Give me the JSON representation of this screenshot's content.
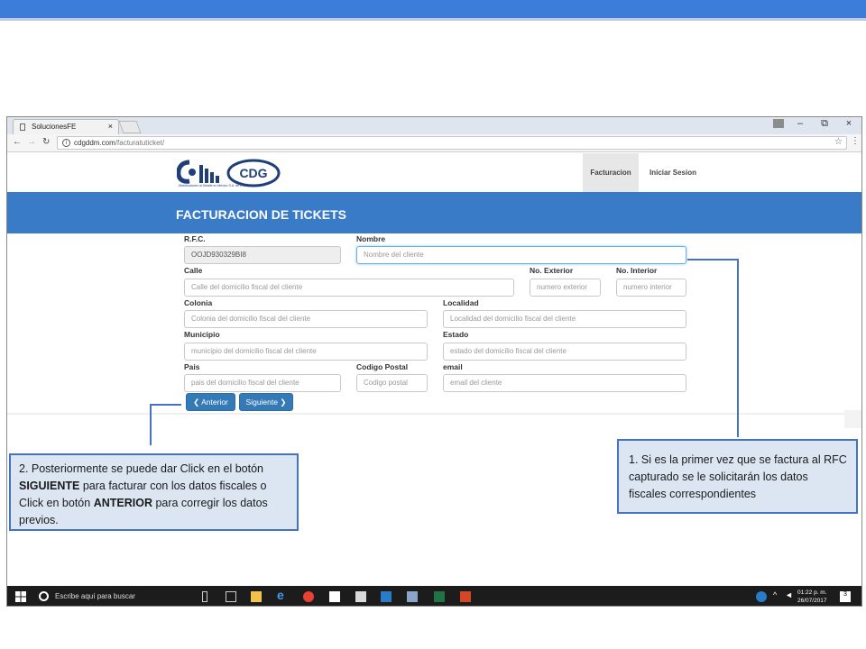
{
  "browser": {
    "tab_title": "SolucionesFE",
    "tab_close": "×",
    "url_domain": "cdgddm.com",
    "url_path": "/facturatuticket/",
    "win_min": "–",
    "win_max": "⧉",
    "win_close": "×"
  },
  "site": {
    "logo_alt": "CDG",
    "logo_tagline": "Distribuciones al Detalle en México S.A. de C.V.",
    "nav_facturacion": "Facturacion",
    "nav_login": "Iniciar Sesion",
    "banner_title": "FACTURACION DE TICKETS"
  },
  "form": {
    "rfc_label": "R.F.C.",
    "rfc_value": "OOJD930329BI8",
    "nombre_label": "Nombre",
    "nombre_placeholder": "Nombre del cliente",
    "calle_label": "Calle",
    "calle_placeholder": "Calle del domicilio fiscal del cliente",
    "noext_label": "No. Exterior",
    "noext_placeholder": "numero exterior",
    "noint_label": "No. Interior",
    "noint_placeholder": "numero interior",
    "colonia_label": "Colonia",
    "colonia_placeholder": "Colonia del domicilio fiscal del cliente",
    "localidad_label": "Localidad",
    "localidad_placeholder": "Localidad del domicilio fiscal del cliente",
    "municipio_label": "Municipio",
    "municipio_placeholder": "municipio del domicilio fiscal del cliente",
    "estado_label": "Estado",
    "estado_placeholder": "estado del domicilio fiscal del cliente",
    "pais_label": "Pais",
    "pais_placeholder": "pais del domicilio fiscal del cliente",
    "cp_label": "Codigo Postal",
    "cp_placeholder": "Codigo postal",
    "email_label": "email",
    "email_placeholder": "email del cliente",
    "btn_anterior": "❮ Anterior",
    "btn_siguiente": "Siguiente ❯"
  },
  "taskbar": {
    "search_text": "Escribe aquí para buscar",
    "time": "01:22 p. m.",
    "date": "26/07/2017",
    "notif_count": "3"
  },
  "callouts": {
    "c1_part1": "1. Si es la primer  vez que se factura al RFC  capturado se le solicitarán los datos fiscales correspondientes",
    "c2_part1": "2. Posteriormente  se puede dar  Click en el botón  ",
    "c2_bold1": "SIGUIENTE",
    "c2_part2": " para facturar con  los datos fiscales o Click en botón  ",
    "c2_bold2": "ANTERIOR",
    "c2_part3": " para corregir los datos previos."
  },
  "colors": {
    "slide_accent": "#3b7dd8",
    "banner": "#3a7bc8",
    "button": "#337ab7",
    "callout_fill": "#dce6f2",
    "callout_border": "#4472c4"
  }
}
